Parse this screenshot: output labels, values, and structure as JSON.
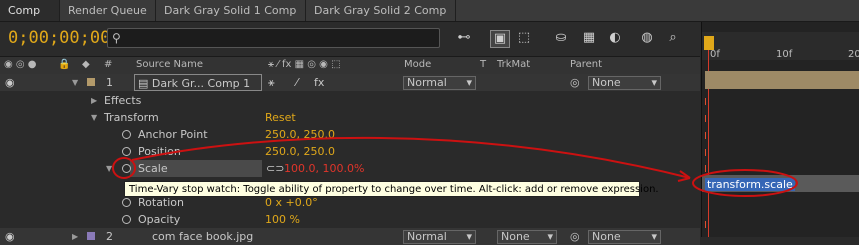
{
  "tabs": [
    {
      "label": "Comp 1",
      "active": true
    },
    {
      "label": "Render Queue",
      "active": false
    },
    {
      "label": "Dark Gray Solid 1 Comp 1",
      "active": false
    },
    {
      "label": "Dark Gray Solid 2 Comp 1",
      "active": false
    }
  ],
  "toolbar": {
    "timecode": "0;00;00;00",
    "search_placeholder": ""
  },
  "header": {
    "col_num": "#",
    "source_name": "Source Name",
    "mode": "Mode",
    "t": "T",
    "trkmat": "TrkMat",
    "parent": "Parent"
  },
  "layer1": {
    "number": "1",
    "name": "Dark Gr... Comp 1",
    "mode": "Normal",
    "parent": "None"
  },
  "props": {
    "effects": "Effects",
    "transform": "Transform",
    "reset": "Reset",
    "anchor_label": "Anchor Point",
    "anchor_value": "250.0, 250.0",
    "position_label": "Position",
    "position_value": "250.0, 250.0",
    "scale_label": "Scale",
    "scale_value": "100.0, 100.0%",
    "rotation_label": "Rotation",
    "rotation_value": "0 x +0.0°",
    "opacity_label": "Opacity",
    "opacity_value": "100 %"
  },
  "layer2": {
    "number": "2",
    "name": "com face book.jpg",
    "mode": "Normal",
    "trkmat": "None",
    "parent": "None"
  },
  "timeline": {
    "tick_0": "0f",
    "tick_10": "10f",
    "tick_20": "20",
    "expression": "transform.scale"
  },
  "tooltip": {
    "text": "Time-Vary stop watch: Toggle ability of property to change over time. Alt-click: add or remove expression."
  },
  "colors": {
    "timecode": "#e0a81a",
    "value": "#e0a81a",
    "scale_value": "#e0352a",
    "annotation": "#cc1111",
    "expression_highlight": "#3566b6"
  }
}
